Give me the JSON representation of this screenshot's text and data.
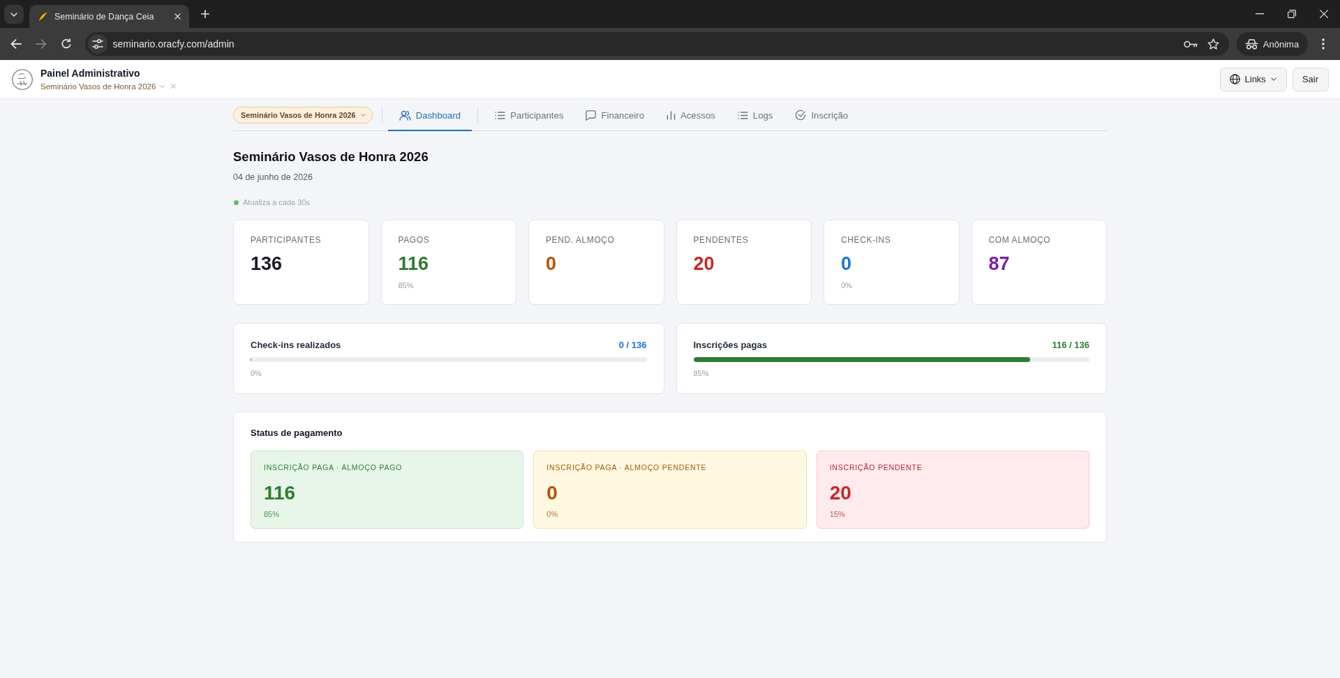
{
  "browser": {
    "tab_title": "Seminário de Dança Ceia",
    "url": "seminario.oracfy.com/admin",
    "forward_disabled": true,
    "profile": "Anônima"
  },
  "header": {
    "title": "Painel Administrativo",
    "event": "Seminário Vasos de Honra 2026",
    "buttons": [
      {
        "kind": "dropdown",
        "label": "Links"
      },
      {
        "kind": "action",
        "label": "Sair"
      }
    ]
  },
  "nav": {
    "event_selector": "Seminário Vasos de Honra 2026",
    "tabs": [
      {
        "label": "Dashboard",
        "selected": true
      },
      {
        "label": "Participantes",
        "selected": false
      },
      {
        "label": "Financeiro",
        "selected": false
      },
      {
        "label": "Acessos",
        "selected": false
      },
      {
        "label": "Logs",
        "selected": false
      },
      {
        "label": "Inscrição",
        "selected": false
      }
    ]
  },
  "event": {
    "title": "Seminário Vasos de Honra 2026",
    "date": "04 de junho de 2026",
    "refresh_note": "Atualiza a cada 30s"
  },
  "stats": [
    {
      "label": "PARTICIPANTES",
      "value": "136",
      "color": "#1a1a2e"
    },
    {
      "label": "PAGOS",
      "value": "116",
      "note": "85%",
      "color": "#2e7d32"
    },
    {
      "label": "PEND. ALMOÇO",
      "value": "0",
      "color": "#b45309"
    },
    {
      "label": "PENDENTES",
      "value": "20",
      "color": "#c62828"
    },
    {
      "label": "CHECK-INS",
      "value": "0",
      "note": "0%",
      "color": "#1976d2"
    },
    {
      "label": "COM ALMOÇO",
      "value": "87",
      "color": "#7b1fa2"
    }
  ],
  "progress": [
    {
      "label": "Check-ins realizados",
      "reading": "0 / 136",
      "level": 0,
      "percent": "0%",
      "color": "#1976d2"
    },
    {
      "label": "Inscrições pagas",
      "reading": "116 / 136",
      "level": 0.85,
      "percent": "85%",
      "color": "#2e7d32"
    }
  ],
  "payment_status": {
    "title": "Status de pagamento",
    "groups": [
      {
        "kind": "paid",
        "label": "INSCRIÇÃO PAGA · ALMOÇO PAGO",
        "value": "116",
        "percent": "85%"
      },
      {
        "kind": "lunch_pending",
        "label": "INSCRIÇÃO PAGA · ALMOÇO PENDENTE",
        "value": "0",
        "percent": "0%"
      },
      {
        "kind": "pending",
        "label": "INSCRIÇÃO PENDENTE",
        "value": "20",
        "percent": "15%"
      }
    ]
  }
}
